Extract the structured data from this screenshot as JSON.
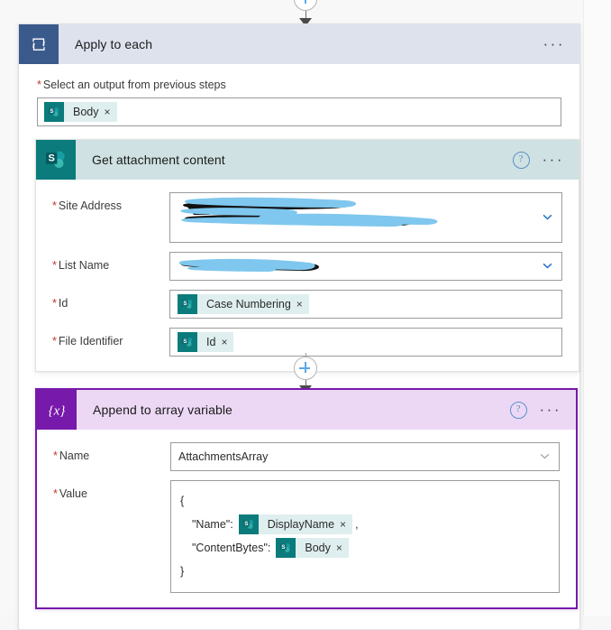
{
  "connectors": [
    {
      "name": "add-step-top",
      "icon": "plus-icon"
    },
    {
      "name": "add-step-middle",
      "icon": "plus-icon"
    }
  ],
  "scope": {
    "title": "Apply to each",
    "icon": "loop-icon",
    "header_color": "#3a5a8c",
    "menu_label": "···",
    "field": {
      "label": "Select an output from previous steps",
      "required_marker": "*",
      "token": {
        "label": "Body",
        "icon": "sharepoint-icon",
        "remove_label": "×"
      }
    }
  },
  "actions": [
    {
      "id": "get-attachment-content",
      "title": "Get attachment content",
      "icon": "sharepoint-icon",
      "header_color": "#0b7b7b",
      "help_label": "?",
      "menu_label": "···",
      "selected": false,
      "fields": [
        {
          "label": "Site Address",
          "required_marker": "*",
          "type": "redacted-combobox",
          "redaction_lines": 2,
          "chevron": "chevron-down-icon"
        },
        {
          "label": "List Name",
          "required_marker": "*",
          "type": "redacted-combobox",
          "redaction_lines": 1,
          "chevron": "chevron-down-icon"
        },
        {
          "label": "Id",
          "required_marker": "*",
          "type": "token",
          "token": {
            "label": "Case Numbering",
            "icon": "sharepoint-icon",
            "remove_label": "×"
          }
        },
        {
          "label": "File Identifier",
          "required_marker": "*",
          "type": "token",
          "token": {
            "label": "Id",
            "icon": "sharepoint-icon",
            "remove_label": "×"
          }
        }
      ]
    },
    {
      "id": "append-to-array-variable",
      "title": "Append to array variable",
      "icon": "variables-icon",
      "icon_glyph": "{x}",
      "header_color": "#7719aa",
      "help_label": "?",
      "menu_label": "···",
      "selected": true,
      "fields": [
        {
          "label": "Name",
          "required_marker": "*",
          "type": "select",
          "value": "AttachmentsArray",
          "chevron": "chevron-down-icon"
        },
        {
          "label": "Value",
          "required_marker": "*",
          "type": "json-editor",
          "lines": [
            {
              "text": "{",
              "indent": false
            },
            {
              "text": "\"Name\":",
              "indent": true,
              "token": {
                "label": "DisplayName",
                "icon": "sharepoint-icon",
                "remove_label": "×"
              },
              "suffix": ","
            },
            {
              "text": "\"ContentBytes\":",
              "indent": true,
              "token": {
                "label": "Body",
                "icon": "sharepoint-icon",
                "remove_label": "×"
              },
              "suffix": ""
            },
            {
              "text": "}",
              "indent": false
            }
          ]
        }
      ]
    }
  ],
  "colors": {
    "scope_accent": "#3a5a8c",
    "sharepoint_teal": "#0b7b7b",
    "variables_purple": "#7719aa",
    "selection_border": "#7719aa",
    "required_red": "#c0392b",
    "redaction_highlight": "#7fc7ee",
    "redaction_stroke": "#111111"
  }
}
